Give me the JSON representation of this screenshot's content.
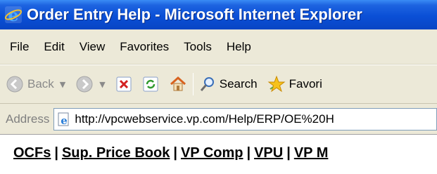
{
  "window": {
    "title": "Order Entry Help - Microsoft Internet Explorer",
    "icon": "internet-explorer-icon"
  },
  "menubar": {
    "items": [
      "File",
      "Edit",
      "View",
      "Favorites",
      "Tools",
      "Help"
    ]
  },
  "toolbar": {
    "back_label": "Back",
    "search_label": "Search",
    "favorites_label": "Favori",
    "icons": [
      "back-icon",
      "forward-icon",
      "stop-icon",
      "refresh-icon",
      "home-icon",
      "search-icon",
      "favorites-star-icon"
    ]
  },
  "address": {
    "label": "Address",
    "url": "http://vpcwebservice.vp.com/Help/ERP/OE%20H"
  },
  "page": {
    "links": [
      "OCFs",
      "Sup. Price Book",
      "VP Comp",
      "VPU",
      "VP M"
    ],
    "separator": "|"
  },
  "colors": {
    "titlebar": "#0a4fd6",
    "chrome": "#ece9d8",
    "address_border": "#7f9db9"
  }
}
